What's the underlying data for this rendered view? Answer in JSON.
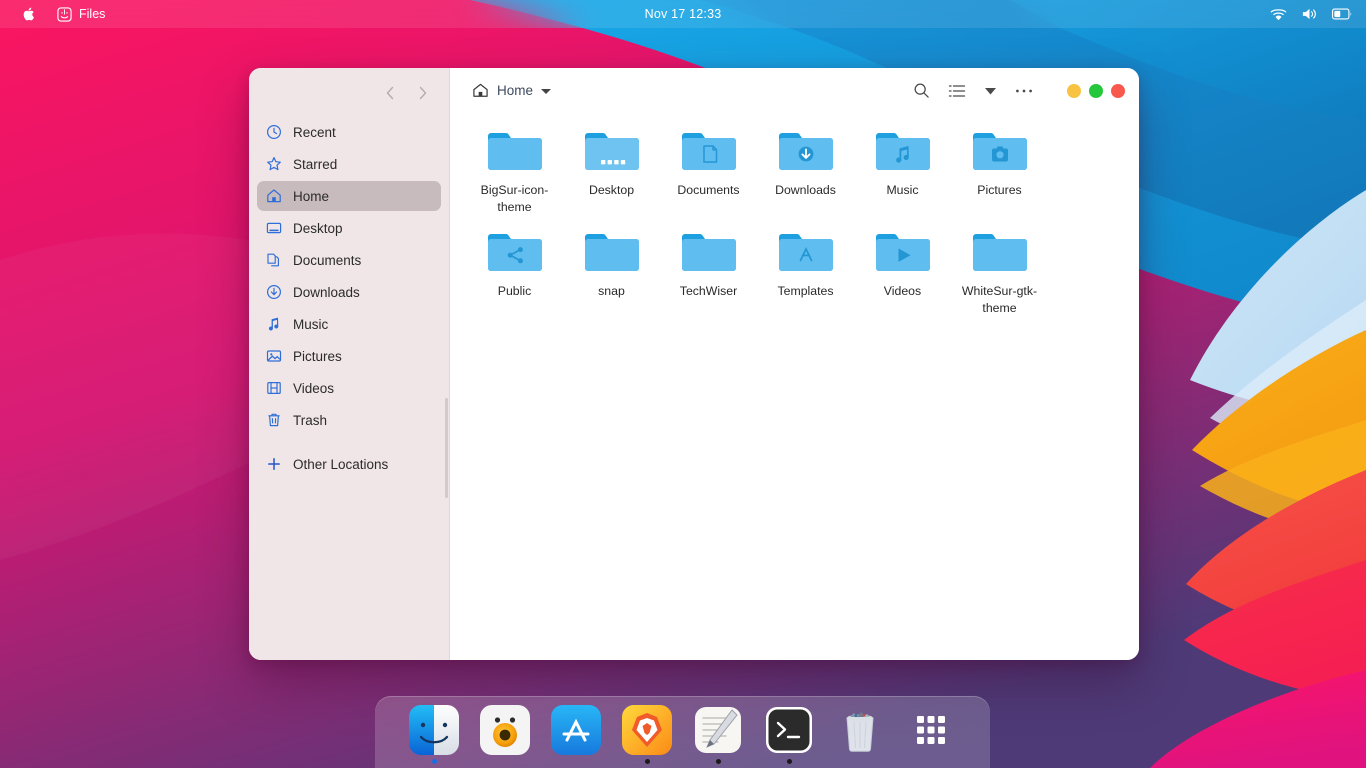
{
  "topbar": {
    "apple_icon": "apple-logo-icon",
    "app_name": "Files",
    "app_icon": "finder-icon",
    "datetime": "Nov 17  12:33",
    "status_icons": [
      "wifi-icon",
      "volume-icon",
      "battery-icon"
    ]
  },
  "window": {
    "title": "Files",
    "nav": {
      "back": "back-arrow-icon",
      "forward": "forward-arrow-icon"
    },
    "breadcrumb": {
      "icon": "home-icon",
      "label": "Home",
      "caret": "chevron-down-icon"
    },
    "header_actions": [
      {
        "name": "search-icon",
        "label": "Search"
      },
      {
        "name": "list-view-icon",
        "label": "View"
      },
      {
        "name": "view-options-caret-icon",
        "label": "View options"
      },
      {
        "name": "more-options-icon",
        "label": "More options"
      }
    ],
    "controls": [
      {
        "name": "minimize-button",
        "color": "#f7c341"
      },
      {
        "name": "maximize-button",
        "color": "#25c73c"
      },
      {
        "name": "close-button",
        "color": "#f9584d"
      }
    ]
  },
  "sidebar": {
    "items": [
      {
        "label": "Recent",
        "icon": "clock-icon",
        "active": false
      },
      {
        "label": "Starred",
        "icon": "star-icon",
        "active": false
      },
      {
        "label": "Home",
        "icon": "home-icon",
        "active": true
      },
      {
        "label": "Desktop",
        "icon": "desktop-icon",
        "active": false
      },
      {
        "label": "Documents",
        "icon": "documents-icon",
        "active": false
      },
      {
        "label": "Downloads",
        "icon": "download-icon",
        "active": false
      },
      {
        "label": "Music",
        "icon": "music-note-icon",
        "active": false
      },
      {
        "label": "Pictures",
        "icon": "image-icon",
        "active": false
      },
      {
        "label": "Videos",
        "icon": "film-icon",
        "active": false
      },
      {
        "label": "Trash",
        "icon": "trash-icon",
        "active": false
      }
    ],
    "other_locations": {
      "label": "Other Locations",
      "icon": "plus-icon"
    }
  },
  "files": [
    {
      "name": "BigSur-icon-theme",
      "icon": "folder-plain-icon",
      "selected": false
    },
    {
      "name": "Desktop",
      "icon": "folder-desktop-icon",
      "selected": true
    },
    {
      "name": "Documents",
      "icon": "folder-documents-icon",
      "selected": false
    },
    {
      "name": "Downloads",
      "icon": "folder-downloads-icon",
      "selected": false
    },
    {
      "name": "Music",
      "icon": "folder-music-icon",
      "selected": false
    },
    {
      "name": "Pictures",
      "icon": "folder-pictures-icon",
      "selected": false
    },
    {
      "name": "Public",
      "icon": "folder-public-icon",
      "selected": false
    },
    {
      "name": "snap",
      "icon": "folder-plain-icon",
      "selected": false
    },
    {
      "name": "TechWiser",
      "icon": "folder-plain-icon",
      "selected": false
    },
    {
      "name": "Templates",
      "icon": "folder-templates-icon",
      "selected": false
    },
    {
      "name": "Videos",
      "icon": "folder-videos-icon",
      "selected": false
    },
    {
      "name": "WhiteSur-gtk-theme",
      "icon": "folder-plain-icon",
      "selected": false
    }
  ],
  "dock": {
    "items": [
      {
        "label": "Finder",
        "icon": "finder-icon",
        "running": true,
        "dot": "blue"
      },
      {
        "label": "Webcam",
        "icon": "webcam-icon",
        "running": false,
        "dot": "none"
      },
      {
        "label": "App Store",
        "icon": "app-store-icon",
        "running": false,
        "dot": "none"
      },
      {
        "label": "Brave",
        "icon": "brave-icon",
        "running": true,
        "dot": "dark"
      },
      {
        "label": "Text Editor",
        "icon": "text-editor-icon",
        "running": true,
        "dot": "dark"
      },
      {
        "label": "Terminal",
        "icon": "terminal-icon",
        "running": true,
        "dot": "dark"
      },
      {
        "label": "Trash",
        "icon": "trash-can-icon",
        "running": false,
        "dot": "none"
      },
      {
        "label": "Show Applications",
        "icon": "app-grid-icon",
        "running": false,
        "dot": "none"
      }
    ]
  },
  "colors": {
    "accent_blue": "#2e6ed8",
    "folder_blue": "#56b9ee",
    "sidebar_bg": "#f0e6e8",
    "selected_row": "#c8bbbe",
    "wallpaper_pink": "#f8215f",
    "wallpaper_blue": "#18a4e0",
    "wallpaper_orange": "#f7a01b",
    "wallpaper_red": "#f4423a"
  }
}
